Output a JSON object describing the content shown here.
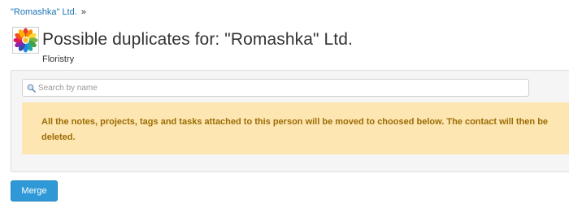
{
  "breadcrumb": {
    "company_link": "\"Romashka\" Ltd.",
    "separator": "»"
  },
  "header": {
    "logo_icon": "daisy-logo-icon",
    "title": "Possible duplicates for: \"Romashka\" Ltd.",
    "subtitle": "Floristry"
  },
  "search": {
    "icon": "search-icon",
    "placeholder": "Search by name",
    "value": ""
  },
  "alert": {
    "message": "All the notes, projects, tags and tasks attached to this person will be moved to choosed below. The contact will then be deleted."
  },
  "actions": {
    "merge_label": "Merge"
  },
  "colors": {
    "link": "#1a73b5",
    "alert_bg": "#fde6b1",
    "alert_text": "#9c6c05",
    "button_bg": "#2e99d6"
  }
}
